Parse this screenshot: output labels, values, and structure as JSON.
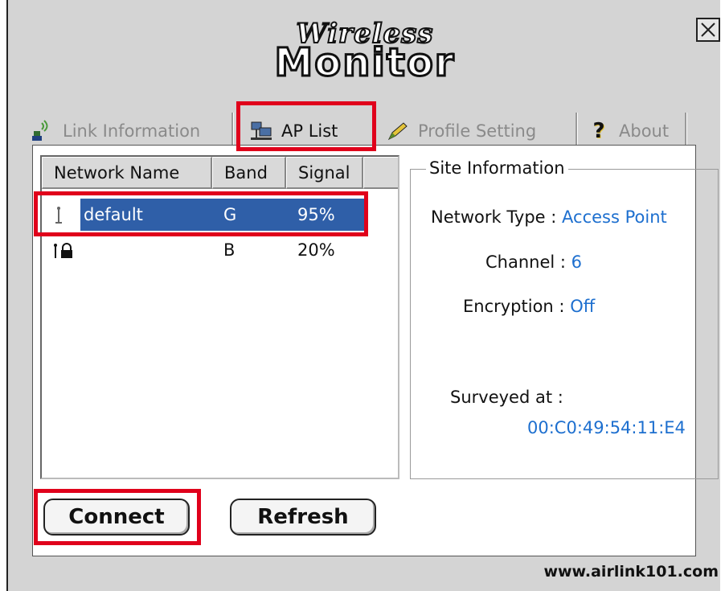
{
  "window": {
    "logo_line1": "Wireless",
    "logo_line2": "Monitor",
    "close_icon": "close-icon",
    "footer_url": "www.airlink101.com"
  },
  "tabs": [
    {
      "label": "Link Information",
      "icon": "signal-icon",
      "active": false
    },
    {
      "label": "AP List",
      "icon": "network-computers-icon",
      "active": true
    },
    {
      "label": "Profile Setting",
      "icon": "pencil-icon",
      "active": false
    },
    {
      "label": "About",
      "icon": "question-icon",
      "active": false
    }
  ],
  "ap_list": {
    "columns": [
      "Network Name",
      "Band",
      "Signal"
    ],
    "rows": [
      {
        "name": "default",
        "band": "G",
        "signal": "95%",
        "icon": "access-point-icon",
        "locked": false,
        "selected": true
      },
      {
        "name": "",
        "band": "B",
        "signal": "20%",
        "icon": "access-point-lock-icon",
        "locked": true,
        "selected": false
      }
    ]
  },
  "site_info": {
    "title": "Site Information",
    "network_type_label": "Network Type :",
    "network_type_value": "Access Point",
    "channel_label": "Channel :",
    "channel_value": "6",
    "encryption_label": "Encryption :",
    "encryption_value": "Off",
    "surveyed_label": "Surveyed at :",
    "surveyed_value": "00:C0:49:54:11:E4"
  },
  "buttons": {
    "connect": "Connect",
    "refresh": "Refresh"
  },
  "colors": {
    "highlight": "#e0001b",
    "selection": "#2f5fa8",
    "value_text": "#1d6fcf"
  }
}
